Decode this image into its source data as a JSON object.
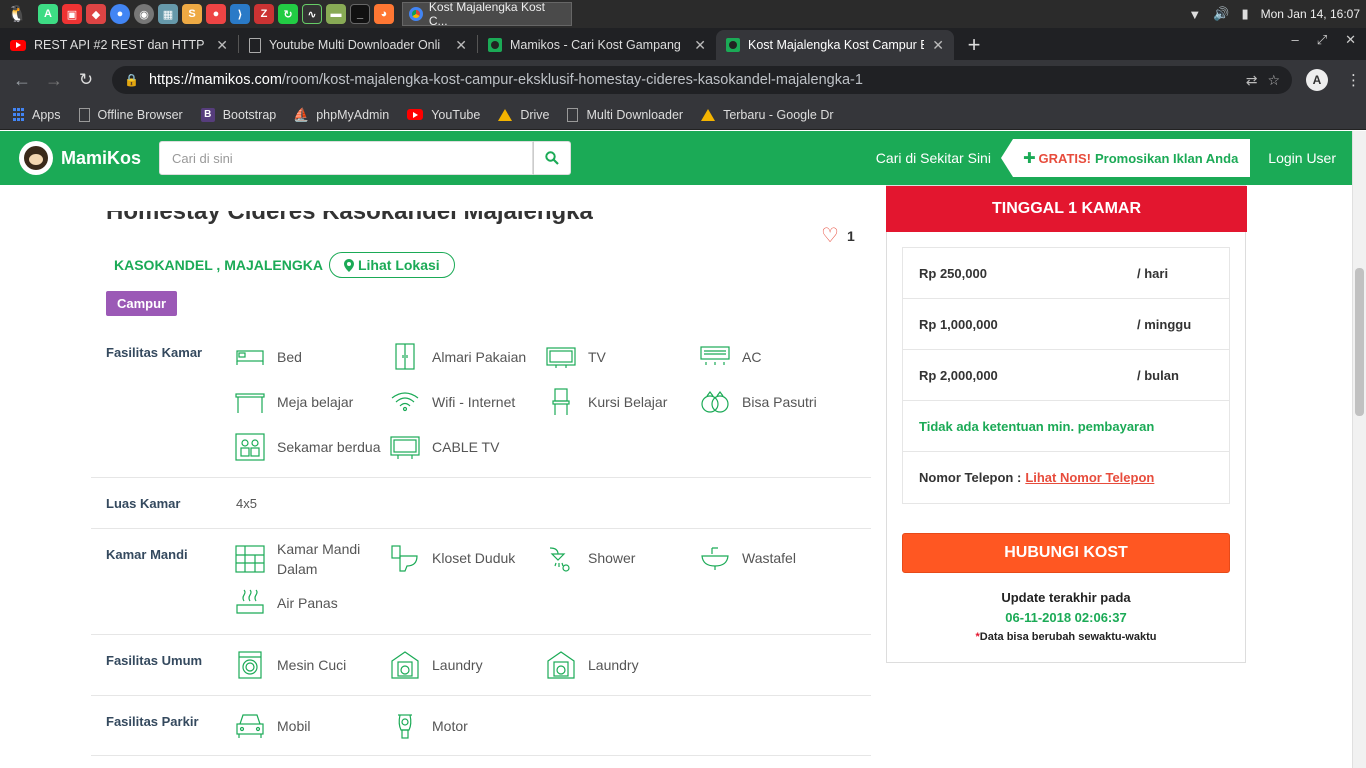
{
  "os_panel": {
    "task_title": "Kost Majalengka Kost C...",
    "clock": "Mon Jan 14, 16:07"
  },
  "tabs": [
    {
      "title": "REST API #2 REST dan HTTP - Yo",
      "favicon": "youtube-icon"
    },
    {
      "title": "Youtube Multi Downloader Onli",
      "favicon": "page-icon"
    },
    {
      "title": "Mamikos - Cari Kost Gampang",
      "favicon": "mamikos-icon"
    },
    {
      "title": "Kost Majalengka Kost Campur E",
      "favicon": "mamikos-icon",
      "active": true
    }
  ],
  "address_bar": {
    "host": "https://mamikos.com",
    "path": "/room/kost-majalengka-kost-campur-eksklusif-homestay-cideres-kasokandel-majalengka-1"
  },
  "bookmarks": [
    "Apps",
    "Offline Browser",
    "Bootstrap",
    "phpMyAdmin",
    "YouTube",
    "Drive",
    "Multi Downloader",
    "Terbaru - Google Dr"
  ],
  "site_header": {
    "brand": "MamiKos",
    "search_placeholder": "Cari di sini",
    "nearby_link": "Cari di Sekitar Sini",
    "promo_gratis": "GRATIS!",
    "promo_text": "Promosikan Iklan Anda",
    "login": "Login User"
  },
  "listing": {
    "title_partial": "Homestay Cideres Kasokandel Majalengka",
    "favorite_count": "1",
    "location": "KASOKANDEL , MAJALENGKA",
    "location_button": "Lihat Lokasi",
    "gender": "Campur"
  },
  "facilities": {
    "kamar": {
      "label": "Fasilitas Kamar",
      "items": [
        "Bed",
        "Almari Pakaian",
        "TV",
        "AC",
        "Meja belajar",
        "Wifi - Internet",
        "Kursi Belajar",
        "Bisa Pasutri",
        "Sekamar berdua",
        "CABLE TV"
      ]
    },
    "luas": {
      "label": "Luas Kamar",
      "value": "4x5"
    },
    "mandi": {
      "label": "Kamar Mandi",
      "items": [
        "Kamar Mandi Dalam",
        "Kloset Duduk",
        "Shower",
        "Wastafel",
        "Air Panas"
      ]
    },
    "umum": {
      "label": "Fasilitas Umum",
      "items": [
        "Mesin Cuci",
        "Laundry",
        "Laundry"
      ]
    },
    "parkir": {
      "label": "Fasilitas Parkir",
      "items": [
        "Mobil",
        "Motor"
      ]
    }
  },
  "price_card": {
    "header": "TINGGAL 1 KAMAR",
    "prices": [
      {
        "value": "Rp 250,000",
        "period": "/ hari"
      },
      {
        "value": "Rp 1,000,000",
        "period": "/ minggu"
      },
      {
        "value": "Rp 2,000,000",
        "period": "/ bulan"
      }
    ],
    "min_payment": "Tidak ada ketentuan min. pembayaran",
    "phone_label": "Nomor Telepon :",
    "phone_link": "Lihat Nomor Telepon",
    "contact_button": "HUBUNGI KOST",
    "updated_label": "Update terakhir pada",
    "updated_date": "06-11-2018 02:06:37",
    "disclaimer_mark": "*",
    "disclaimer": "Data bisa berubah sewaktu-waktu"
  },
  "colors": {
    "brand_green": "#1baa56",
    "header_red": "#e3162f",
    "contact_orange": "#ff5722",
    "badge_purple": "#9b59b6"
  }
}
